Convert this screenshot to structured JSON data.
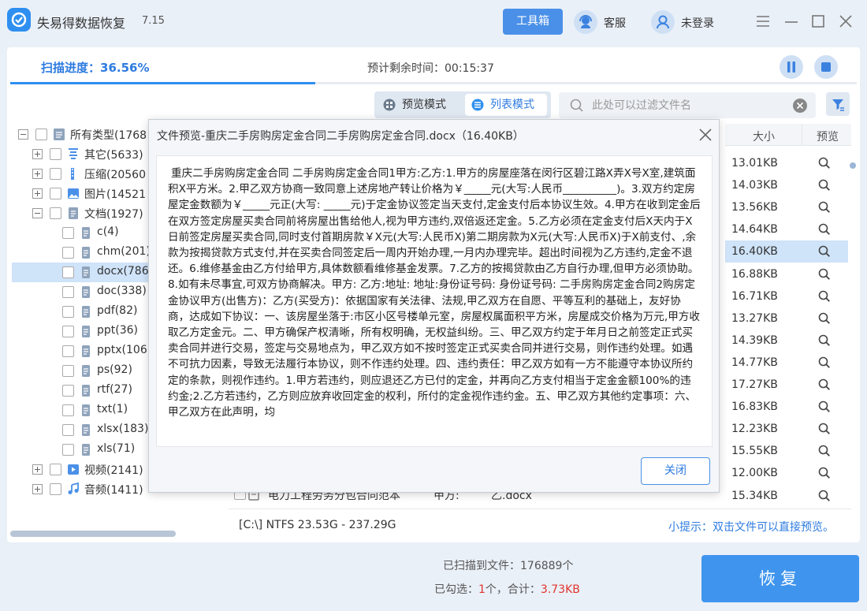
{
  "app": {
    "title": "失易得数据恢复",
    "version": "7.15"
  },
  "header": {
    "toolbox": "工具箱",
    "service": "客服",
    "login": "未登录"
  },
  "scan": {
    "progress_label": "扫描进度：36.56%",
    "progress_fraction": 0.3656,
    "remaining": "预计剩余时间：00:15:37"
  },
  "view": {
    "preview_mode": "预览模式",
    "list_mode": "列表模式",
    "filter_placeholder": "此处可以过滤文件名"
  },
  "tree": {
    "root": "所有类型(1768",
    "other": "其它(5633)",
    "compressed": "压缩(20560",
    "images": "图片(14521",
    "documents": "文档(1927)",
    "doc_types": [
      "c(4)",
      "chm(201)",
      "docx(786",
      "doc(338)",
      "pdf(82)",
      "ppt(36)",
      "pptx(106",
      "ps(92)",
      "rtf(27)",
      "txt(1)",
      "xlsx(183)",
      "xls(71)"
    ],
    "video": "视频(2141)",
    "audio": "音频(1411)"
  },
  "table": {
    "col_size": "大小",
    "col_preview": "预览",
    "sizes": [
      "13.01KB",
      "14.03KB",
      "13.56KB",
      "14.64KB",
      "16.40KB",
      "16.88KB",
      "16.71KB",
      "13.27KB",
      "14.39KB",
      "14.77KB",
      "17.27KB",
      "16.83KB",
      "12.23KB",
      "15.55KB",
      "12.00KB",
      "15.34KB"
    ],
    "last_row": {
      "name": "电力工程劳务分包合同范本",
      "col2": "甲方:",
      "col3": "乙.docx"
    }
  },
  "status": {
    "drive": "[C:\\] NTFS 23.53G - 237.29G",
    "tip": "小提示：双击文件可以直接预览。"
  },
  "footer": {
    "scanned": "已扫描到文件：176889个",
    "selected_prefix": "已勾选：",
    "selected_count": "1",
    "selected_mid": "个，合计：",
    "selected_size": "3.73KB",
    "recover": "恢复"
  },
  "dialog": {
    "title": "文件预览-重庆二手房购房定金合同二手房购房定金合同.docx（16.40KB）",
    "content": "重庆二手房购房定金合同  二手房购房定金合同1甲方:乙方:1.甲方的房屋座落在闵行区碧江路X弄X号X室,建筑面积X平方米。2.甲乙双方协商一致同意上述房地产转让价格为￥_____元(大写:人民币__________)。3.双方约定房屋定金数额为￥_____元正(大写: _____元)于定金协议签定当天支付,定金支付后本协议生效。4.甲方在收到定金后在双方签定房屋买卖合同前将房屋出售给他人,视为甲方违约,双倍返还定金。5.乙方必须在定金支付后X天内于X日前签定房屋买卖合同,同时支付首期房款￥X元(大写:人民币X)第二期房款为X元(大写:人民币X)于X前支付、,余款为按揭贷款方式支付,并在买卖合同签定后一周内开始办理,一月内办理完毕。超出时间视为乙方违约,定金不退还。6.维修基金由乙方付给甲方,具体数额看维修基金发票。7.乙方的按揭贷款由乙方自行办理,但甲方必须协助。8.如有未尽事宜,可双方协商解决。甲方:                    乙方:地址:                    地址:身份证号码:                    身份证号码: 二手房购房定金合同2购房定金协议甲方(出售方)：乙方(买受方)：依据国家有关法律、法规,甲乙双方在自愿、平等互利的基础上，友好协商，达成如下协议：一、该房屋坐落于:市区小区号楼单元室，房屋权属面积平方米，房屋成交价格为万元,甲方收取乙方定金元。二、甲方确保产权清晰，所有权明确，无权益纠纷。三、甲乙双方约定于年月日之前签定正式买卖合同并进行交易，签定与交易地点为，甲乙双方如不按时签定正式买卖合同并进行交易，则作违约处理。如遇不可抗力因素，导致无法履行本协议，则不作违约处理。四、违约责任：甲乙双方如有一方不能遵守本协议所约定的条款，则视作违约。1.甲方若违约，则应退还乙方已付的定金，并再向乙方支付相当于定金金额100%的违约金;2.乙方若违约，乙方则应放弃收回定金的权利，所付的定金视作违约金。五、甲乙双方其他约定事项：六、甲乙双方在此声明，均",
    "close_button": "关闭"
  }
}
